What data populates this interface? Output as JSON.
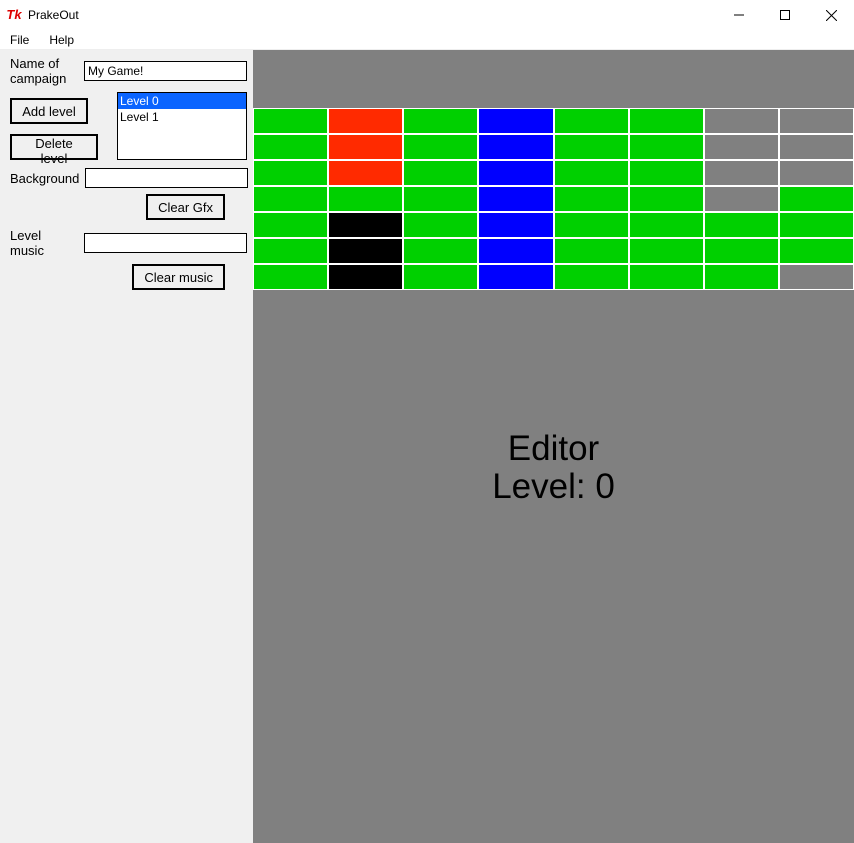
{
  "window": {
    "app_icon_text": "Tk",
    "title": "PrakeOut"
  },
  "menubar": {
    "file": "File",
    "help": "Help"
  },
  "sidebar": {
    "campaign_label": "Name of campaign",
    "campaign_value": "My Game!",
    "add_level_btn": "Add level",
    "delete_level_btn": "Delete level",
    "levels": [
      "Level 0",
      "Level 1"
    ],
    "selected_level_index": 0,
    "background_label": "Background",
    "background_value": "",
    "clear_gfx_btn": "Clear Gfx",
    "level_music_label": "Level music",
    "level_music_value": "",
    "clear_music_btn": "Clear music"
  },
  "canvas": {
    "label_line1": "Editor",
    "label_line2": "Level: 0",
    "brick_colors": {
      "g": "#00d000",
      "r": "#ff2a00",
      "b": "#0000ff",
      "k": "#000000",
      "s": "#808080"
    },
    "grid": [
      [
        "g",
        "r",
        "g",
        "b",
        "g",
        "g",
        "s",
        "s"
      ],
      [
        "g",
        "r",
        "g",
        "b",
        "g",
        "g",
        "s",
        "s"
      ],
      [
        "g",
        "r",
        "g",
        "b",
        "g",
        "g",
        "s",
        "s"
      ],
      [
        "g",
        "g",
        "g",
        "b",
        "g",
        "g",
        "s",
        "g"
      ],
      [
        "g",
        "k",
        "g",
        "b",
        "g",
        "g",
        "g",
        "g"
      ],
      [
        "g",
        "k",
        "g",
        "b",
        "g",
        "g",
        "g",
        "g"
      ],
      [
        "g",
        "k",
        "g",
        "b",
        "g",
        "g",
        "g",
        "s"
      ]
    ]
  }
}
